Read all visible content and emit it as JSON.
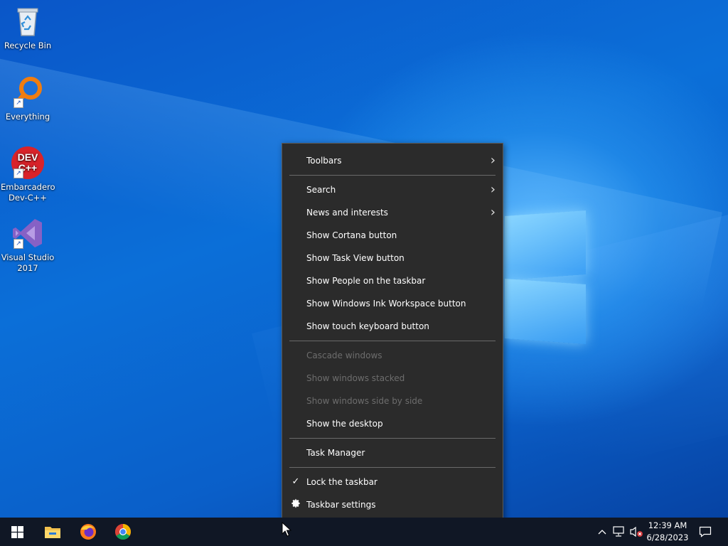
{
  "desktop": {
    "icons": [
      {
        "label": "Recycle Bin"
      },
      {
        "label": "Everything"
      },
      {
        "label_line1": "Embarcadero",
        "label_line2": "Dev-C++"
      },
      {
        "label_line1": "Visual Studio",
        "label_line2": "2017"
      }
    ]
  },
  "context_menu": {
    "toolbars": "Toolbars",
    "search": "Search",
    "news": "News and interests",
    "cortana": "Show Cortana button",
    "task_view": "Show Task View button",
    "people": "Show People on the taskbar",
    "ink": "Show Windows Ink Workspace button",
    "touch_keyboard": "Show touch keyboard button",
    "cascade": "Cascade windows",
    "stacked": "Show windows stacked",
    "side_by_side": "Show windows side by side",
    "show_desktop": "Show the desktop",
    "task_manager": "Task Manager",
    "lock_taskbar": "Lock the taskbar",
    "taskbar_settings": "Taskbar settings",
    "disabled_items": [
      "Cascade windows",
      "Show windows stacked",
      "Show windows side by side"
    ],
    "checked_item": "Lock the taskbar"
  },
  "taskbar": {
    "pinned": [
      "start-button",
      "file-explorer",
      "firefox",
      "chrome"
    ],
    "clock": {
      "time": "12:39 AM",
      "date": "6/28/2023"
    }
  },
  "colors": {
    "menu_bg": "#2b2b2b",
    "taskbar_bg": "#101725",
    "disabled_text": "#6d6d6d"
  }
}
